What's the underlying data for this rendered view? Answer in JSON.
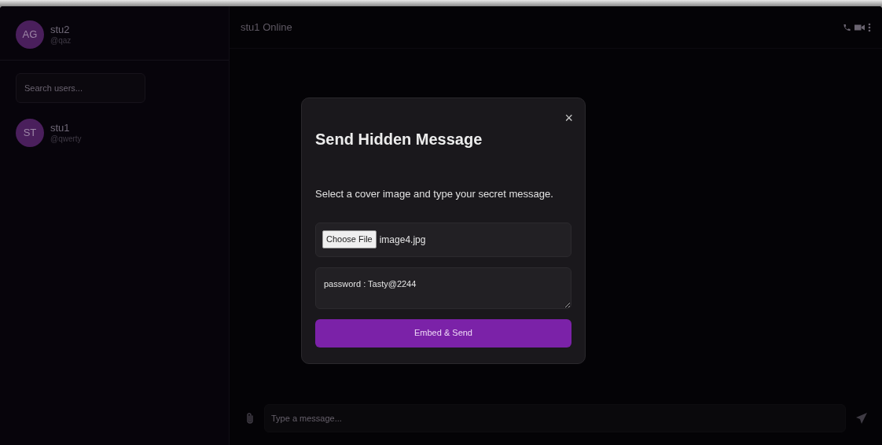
{
  "current_user": {
    "initials": "AG",
    "name": "stu2",
    "handle": "@qaz"
  },
  "search": {
    "placeholder": "Search users..."
  },
  "contacts": [
    {
      "initials": "ST",
      "name": "stu1",
      "handle": "@qwerty"
    }
  ],
  "chat_header": {
    "title": "stu1 Online"
  },
  "composer": {
    "placeholder": "Type a message..."
  },
  "modal": {
    "title": "Send Hidden Message",
    "close": "×",
    "instructions": "Select a cover image and type your secret message.",
    "file_button": "Choose File",
    "file_name": "image4.jpg",
    "message": "password : Tasty@2244",
    "submit": "Embed & Send"
  }
}
